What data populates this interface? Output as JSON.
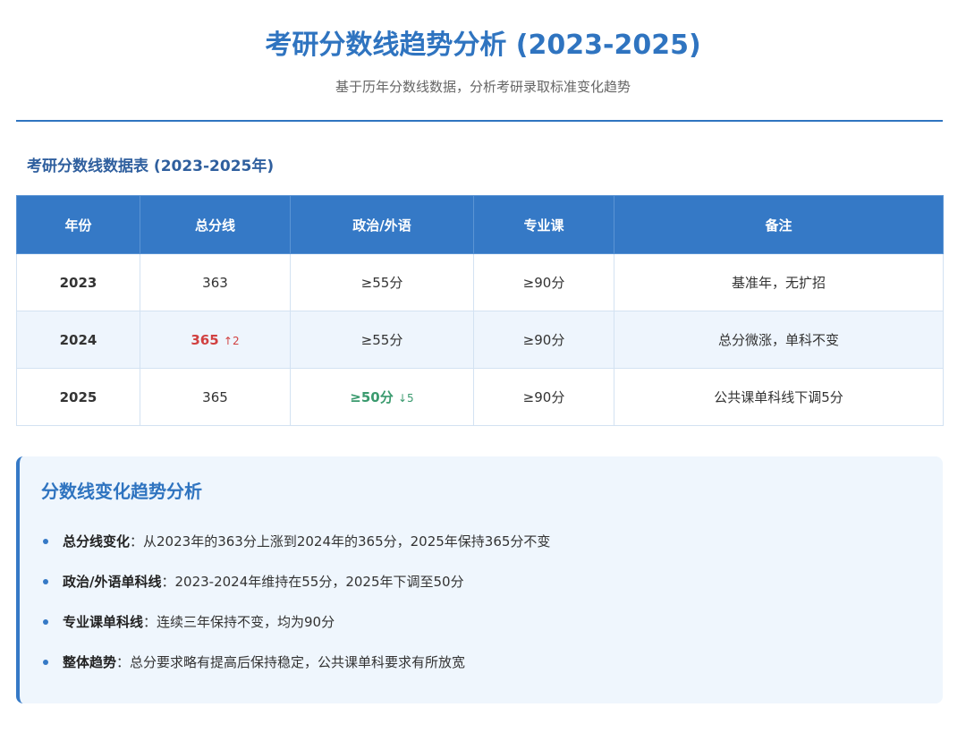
{
  "header": {
    "title": "考研分数线趋势分析 (2023-2025)",
    "subtitle": "基于历年分数线数据，分析考研录取标准变化趋势"
  },
  "table": {
    "title": "考研分数线数据表 (2023-2025年)",
    "columns": [
      "年份",
      "总分线",
      "政治/外语",
      "专业课",
      "备注"
    ],
    "rows": [
      {
        "year": "2023",
        "total": "363",
        "total_delta": "",
        "politics": "≥55分",
        "politics_delta": "",
        "major": "≥90分",
        "note": "基准年，无扩招"
      },
      {
        "year": "2024",
        "total": "365",
        "total_delta": "↑2",
        "politics": "≥55分",
        "politics_delta": "",
        "major": "≥90分",
        "note": "总分微涨，单科不变"
      },
      {
        "year": "2025",
        "total": "365",
        "total_delta": "",
        "politics": "≥50分",
        "politics_delta": "↓5",
        "major": "≥90分",
        "note": "公共课单科线下调5分"
      }
    ],
    "colors": {
      "header_bg": "#3579c6",
      "increase": "#d14040",
      "decrease": "#3a9a6e"
    }
  },
  "analysis": {
    "title": "分数线变化趋势分析",
    "items": [
      {
        "label": "总分线变化",
        "text": "：从2023年的363分上涨到2024年的365分，2025年保持365分不变"
      },
      {
        "label": "政治/外语单科线",
        "text": "：2023-2024年维持在55分，2025年下调至50分"
      },
      {
        "label": "专业课单科线",
        "text": "：连续三年保持不变，均为90分"
      },
      {
        "label": "整体趋势",
        "text": "：总分要求略有提高后保持稳定，公共课单科要求有所放宽"
      }
    ]
  }
}
